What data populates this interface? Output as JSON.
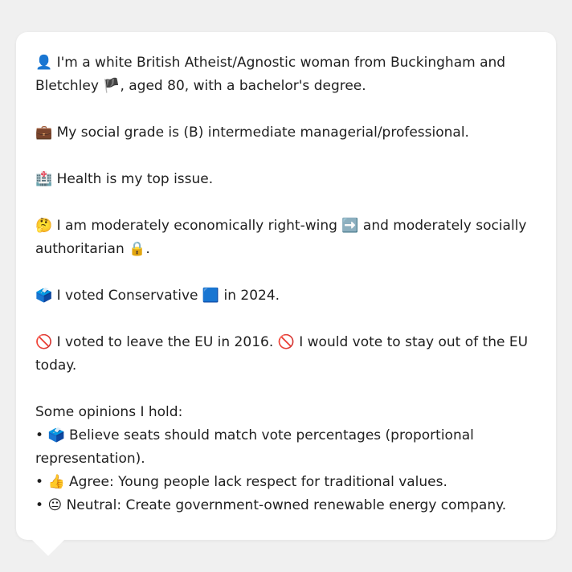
{
  "profile": {
    "line1": {
      "icon": "👤",
      "text_a": "I'm a white British Atheist/Agnostic woman from Buckingham and Bletchley ",
      "flag": "🏴",
      "text_b": ", aged 80, with a bachelor's degree."
    },
    "line2": {
      "icon": "💼",
      "text": "My social grade is (B) intermediate managerial/professional."
    },
    "line3": {
      "icon": "🏥",
      "text": "Health is my top issue."
    },
    "line4": {
      "icon": "🤔",
      "text_a": "I am moderately economically right-wing ",
      "arrow": "➡️",
      "text_b": " and moderately socially authoritarian ",
      "lock": "🔒",
      "text_c": "."
    },
    "line5": {
      "icon": "🗳️",
      "text_a": "I voted Conservative ",
      "square": "🟦",
      "text_b": " in 2024."
    },
    "line6": {
      "icon_a": "🚫",
      "text_a": "I voted to leave the EU in 2016. ",
      "icon_b": "🚫",
      "text_b": "I would vote to stay out of the EU today."
    },
    "opinions_heading": "Some opinions I hold:",
    "opinions": [
      {
        "bullet": "•",
        "icon": "🗳️",
        "text": "Believe seats should match vote percentages (proportional representation)."
      },
      {
        "bullet": "•",
        "icon": "👍",
        "text": "Agree: Young people lack respect for traditional values."
      },
      {
        "bullet": "•",
        "icon": "😐",
        "text": "Neutral: Create government-owned renewable energy company."
      }
    ]
  },
  "colors": {
    "card_bg": "#ffffff",
    "page_bg": "#f0f0f0",
    "text": "#1f1f1f",
    "conservative_blue": "#1f6fe5"
  }
}
